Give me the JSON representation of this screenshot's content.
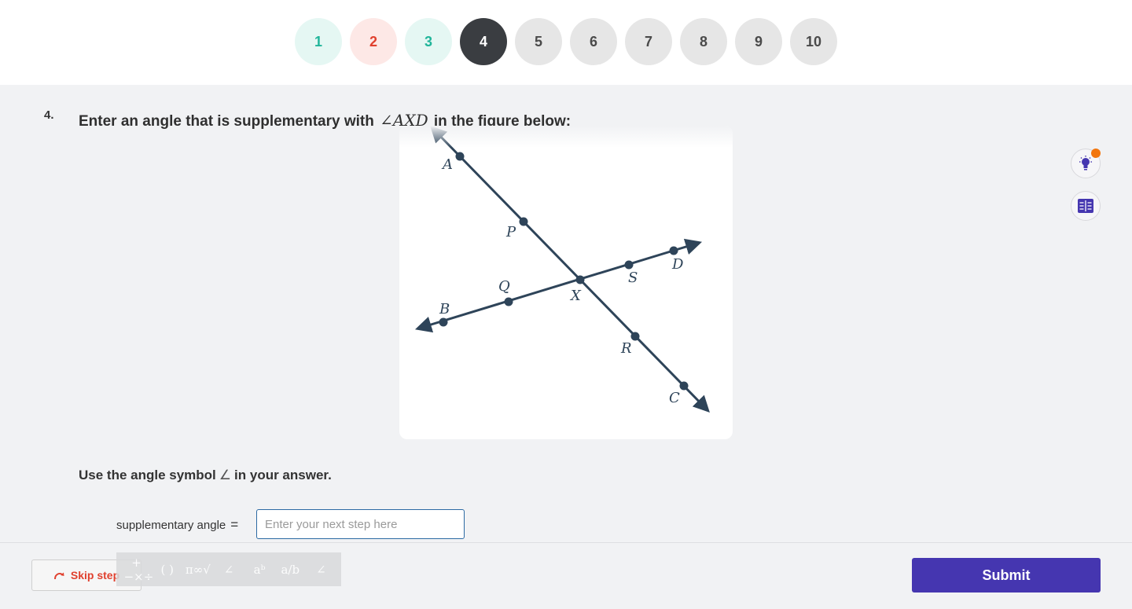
{
  "steps": [
    {
      "label": "1",
      "status": "correct"
    },
    {
      "label": "2",
      "status": "incorrect"
    },
    {
      "label": "3",
      "status": "correct"
    },
    {
      "label": "4",
      "status": "current"
    },
    {
      "label": "5",
      "status": "unanswered"
    },
    {
      "label": "6",
      "status": "unanswered"
    },
    {
      "label": "7",
      "status": "unanswered"
    },
    {
      "label": "8",
      "status": "unanswered"
    },
    {
      "label": "9",
      "status": "unanswered"
    },
    {
      "label": "10",
      "status": "unanswered"
    }
  ],
  "question": {
    "number": "4.",
    "text_before": "Enter an angle that is supplementary with",
    "math": "∠AXD",
    "text_after": "in the figure below:"
  },
  "figure": {
    "points": [
      "A",
      "P",
      "X",
      "R",
      "C",
      "B",
      "Q",
      "S",
      "D"
    ]
  },
  "instruction": {
    "before": "Use the angle symbol",
    "symbol": "∠",
    "after": "in your answer."
  },
  "answer": {
    "label": "supplementary angle",
    "equals": "=",
    "placeholder": "Enter your next step here",
    "value": ""
  },
  "toolbar": {
    "tools": [
      "+−×÷",
      "( )",
      "π∞√",
      "∠",
      "aᵇ",
      "a/b",
      "∠"
    ]
  },
  "footer": {
    "skip_label": "Skip step",
    "submit_label": "Submit"
  },
  "side_tools": [
    "hint-lightbulb-icon",
    "formula-sheet-icon"
  ],
  "colors": {
    "accent": "#4536b0",
    "correct": "#21b59a",
    "incorrect": "#e0402e",
    "current": "#3a3d41",
    "figure_stroke": "#2e4459",
    "notification": "#f2750d"
  }
}
